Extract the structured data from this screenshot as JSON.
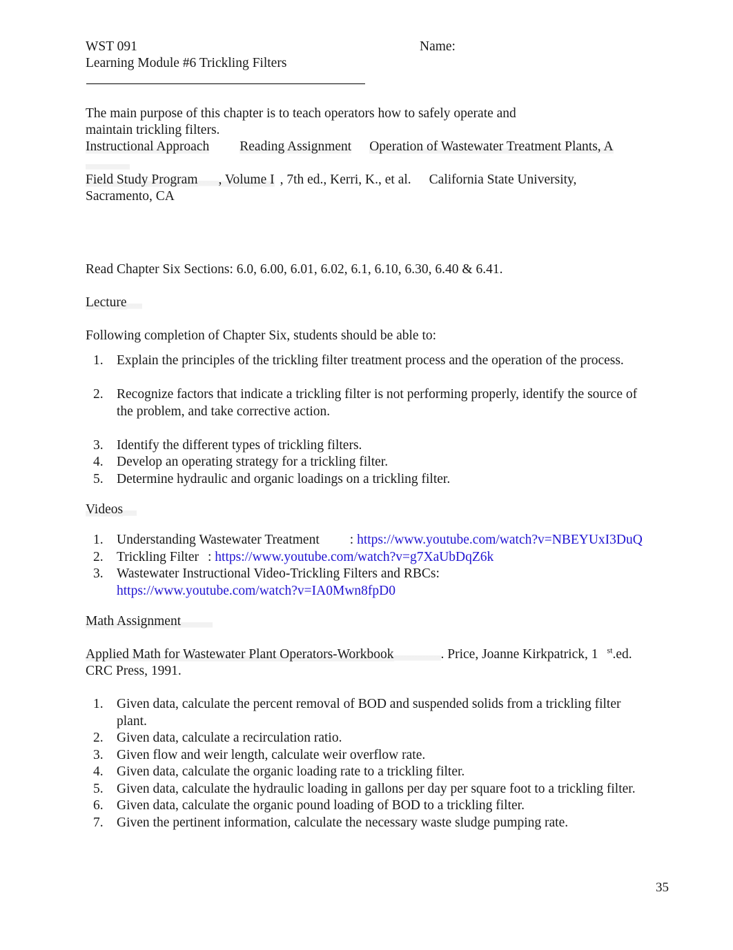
{
  "document": {
    "course_code": "WST 091",
    "module_title": "Learning Module #6 Trickling Filters",
    "name_label": "Name:",
    "page_number": "35"
  },
  "purpose": {
    "line1": "The main purpose of this chapter is to teach operators how to safely operate and",
    "line2": "maintain trickling filters."
  },
  "citation": {
    "instructional_approach_label": "Instructional Approach",
    "reading_assignment_label": "Reading Assignment",
    "book_title_part1": "Operation of Wastewater Treatment Plants, A",
    "book_title_part2": "Field Study Program",
    "volume": ", Volume I",
    "edition_authors": ", 7th ed., Kerri, K., et al.",
    "publisher": "California State University,",
    "publisher_city": "Sacramento, CA"
  },
  "reading": {
    "text": "Read Chapter Six Sections: 6.0, 6.00, 6.01, 6.02, 6.1, 6.10, 6.30, 6.40 & 6.41."
  },
  "lecture": {
    "heading": "Lecture",
    "intro": "Following completion of Chapter Six, students should be able to:",
    "objectives": [
      {
        "num": "1.",
        "text": "Explain the principles of the trickling filter treatment process and the operation of the process."
      },
      {
        "num": "2.",
        "text": "Recognize factors that indicate a trickling filter is not performing properly, identify the source of the problem, and take corrective action."
      },
      {
        "num": "3.",
        "text": "Identify the different types of trickling filters."
      },
      {
        "num": "4.",
        "text": "Develop an operating strategy for a trickling filter."
      },
      {
        "num": "5.",
        "text": "Determine hydraulic and organic loadings on a trickling filter."
      }
    ]
  },
  "videos": {
    "heading": "Videos",
    "items": [
      {
        "num": "1.",
        "label": "Understanding Wastewater Treatment",
        "separator": ":",
        "url": "https://www.youtube.com/watch?v=NBEYUxI3DuQ"
      },
      {
        "num": "2.",
        "label": "Trickling Filter",
        "separator": ":",
        "url": "https://www.youtube.com/watch?v=g7XaUbDqZ6k"
      },
      {
        "num": "3.",
        "label": "Wastewater Instructional Video-Trickling Filters and RBCs:",
        "separator": "",
        "url": "https://www.youtube.com/watch?v=IA0Mwn8fpD0"
      }
    ]
  },
  "math_assignment": {
    "heading": "Math Assignment",
    "reference_title": "Applied Math for Wastewater Plant Operators-Workbook",
    "reference_rest": ". Price, Joanne Kirkpatrick, 1",
    "ordinal_suffix": "st",
    "reference_edition": ".ed.",
    "reference_publisher": "CRC Press, 1991.",
    "problems": [
      {
        "num": "1.",
        "text": "Given data, calculate the percent removal of BOD and suspended solids from a trickling filter plant."
      },
      {
        "num": "2.",
        "text": "Given data, calculate a recirculation ratio."
      },
      {
        "num": "3.",
        "text": "Given flow and weir length, calculate weir overflow rate."
      },
      {
        "num": "4.",
        "text": "Given data, calculate the organic loading rate to a trickling filter."
      },
      {
        "num": "5.",
        "text": "Given data, calculate the hydraulic loading in gallons per day per square foot to a trickling filter."
      },
      {
        "num": "6.",
        "text": "Given data, calculate the organic pound loading of BOD to a trickling filter."
      },
      {
        "num": "7.",
        "text": "Given the pertinent information, calculate the necessary waste sludge pumping rate."
      }
    ]
  },
  "colors": {
    "link": "#2115d1",
    "text": "#1a1a1a"
  }
}
